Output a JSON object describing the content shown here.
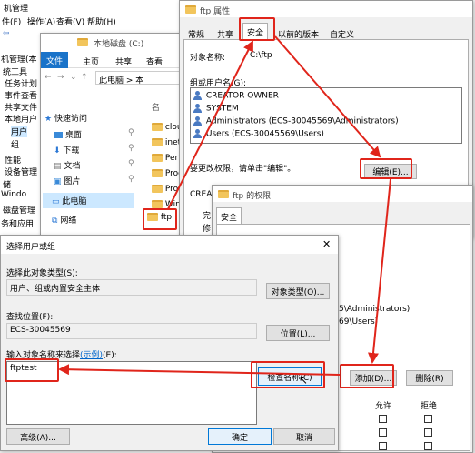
{
  "mgmt": {
    "title": "机管理",
    "menu": [
      "件(F)",
      "操作(A)",
      "查看(V)",
      "帮助(H)"
    ],
    "tree": [
      "机管理(本",
      "统工具",
      "任务计划",
      "事件查看",
      "共享文件",
      "本地用户",
      "用户",
      "组",
      "性能",
      "设备管理",
      "储",
      "Windo",
      "磁盘管理",
      "务和应用"
    ]
  },
  "explorer": {
    "path_title": "本地磁盘 (C:)",
    "ribbon_tabs": [
      "文件",
      "主页",
      "共享",
      "查看"
    ],
    "address": "此电脑 > 本",
    "quick_access": "快速访问",
    "nav": [
      "桌面",
      "下载",
      "文档",
      "图片"
    ],
    "this_pc": "此电脑",
    "network": "网络",
    "folders": [
      "clou",
      "inet",
      "Perf",
      "Prog",
      "Prog",
      "Win"
    ],
    "folder_ftp": "ftp",
    "col_header": "名"
  },
  "props": {
    "title": "ftp 属性",
    "tabs": [
      "常规",
      "共享",
      "安全",
      "以前的版本",
      "自定义"
    ],
    "object_label": "对象名称:",
    "object_value": "C:\\ftp",
    "group_label": "组或用户名(G):",
    "users": [
      "CREATOR OWNER",
      "SYSTEM",
      "Administrators (ECS-30045569\\Administrators)",
      "Users (ECS-30045569\\Users)"
    ],
    "change_hint": "要更改权限，请单击\"编辑\"。",
    "edit_button": "编辑(E)...",
    "crea_label": "CREA",
    "perm_rows": [
      "完",
      "修"
    ]
  },
  "perm": {
    "title": "ftp 的权限",
    "tab": "安全",
    "admin_fragment": "5\\Administrators)",
    "users_fragment": "69\\Users)",
    "add_button": "添加(D)...",
    "remove_button": "删除(R)",
    "allow_header": "允许",
    "deny_header": "拒绝"
  },
  "select": {
    "title": "选择用户或组",
    "object_type_label": "选择此对象类型(S):",
    "object_type_value": "用户、组或内置安全主体",
    "object_type_button": "对象类型(O)...",
    "location_label": "查找位置(F):",
    "location_value": "ECS-30045569",
    "location_button": "位置(L)...",
    "enter_label": "输入对象名称来选择",
    "example_link": "(示例)",
    "enter_label_suffix": "(E):",
    "input_value": "ftptest",
    "check_button": "检查名称(C)",
    "advanced_button": "高级(A)...",
    "ok_button": "确定",
    "cancel_button": "取消"
  },
  "colors": {
    "highlight": "#e0251b",
    "ribbon_blue": "#1a73c9"
  }
}
